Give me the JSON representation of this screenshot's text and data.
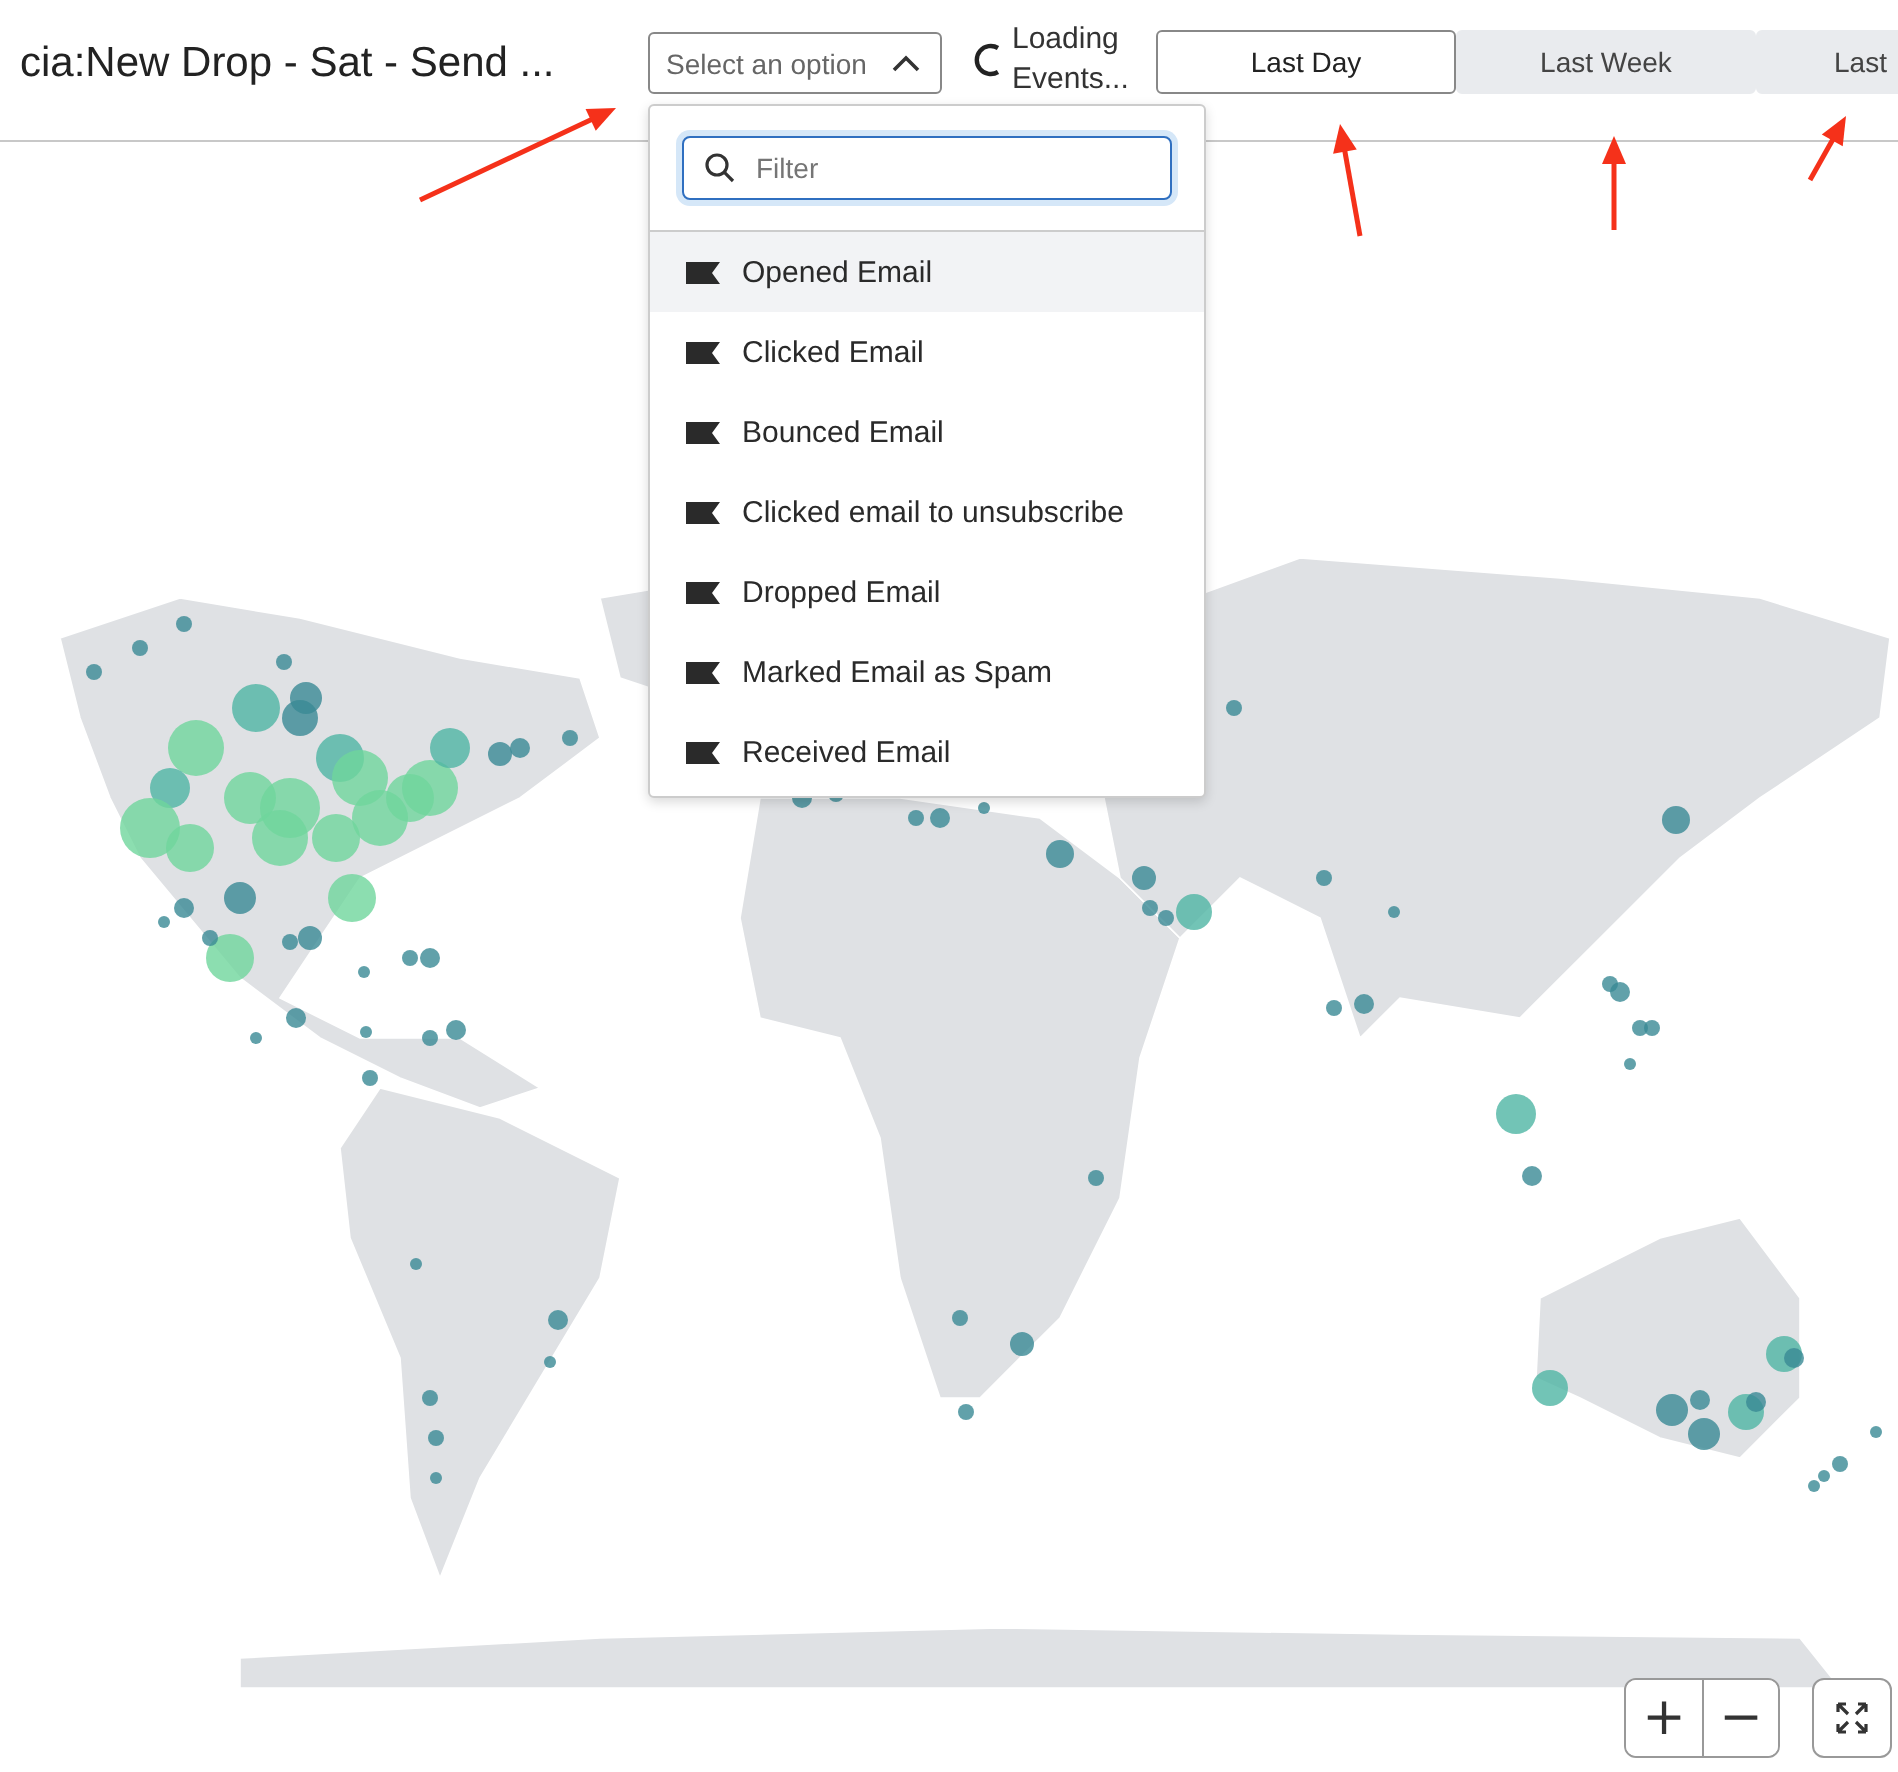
{
  "header": {
    "title": "cia:New Drop - Sat - Send ...",
    "select": {
      "placeholder": "Select an option",
      "expanded": true
    },
    "loading": {
      "text": "Loading Events..."
    }
  },
  "tabs": [
    {
      "label": "Last Day",
      "selected": true
    },
    {
      "label": "Last Week",
      "selected": false
    },
    {
      "label": "Last",
      "selected": false
    }
  ],
  "dropdown": {
    "filter": {
      "placeholder": "Filter"
    },
    "options": [
      {
        "label": "Opened Email",
        "selected": true
      },
      {
        "label": "Clicked Email",
        "selected": false
      },
      {
        "label": "Bounced Email",
        "selected": false
      },
      {
        "label": "Clicked email to unsubscribe",
        "selected": false
      },
      {
        "label": "Dropped Email",
        "selected": false
      },
      {
        "label": "Marked Email as Spam",
        "selected": false
      },
      {
        "label": "Received Email",
        "selected": false
      }
    ]
  },
  "map_controls": {
    "zoom_in": "+",
    "zoom_out": "−"
  }
}
